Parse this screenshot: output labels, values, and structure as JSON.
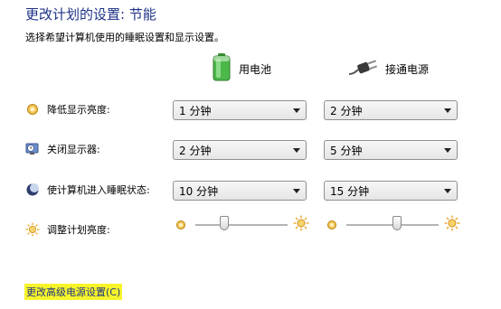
{
  "header": {
    "title": "更改计划的设置: 节能",
    "subtitle": "选择希望计算机使用的睡眠设置和显示设置。"
  },
  "columns": {
    "battery_label": "用电池",
    "ac_label": "接通电源"
  },
  "rows": {
    "dim_display": {
      "label": "降低显示亮度:",
      "battery_value": "1 分钟",
      "ac_value": "2 分钟"
    },
    "turn_off_display": {
      "label": "关闭显示器:",
      "battery_value": "2 分钟",
      "ac_value": "5 分钟"
    },
    "sleep": {
      "label": "使计算机进入睡眠状态:",
      "battery_value": "10 分钟",
      "ac_value": "15 分钟"
    },
    "brightness": {
      "label": "调整计划亮度:",
      "battery_level_percent": 31,
      "ac_level_percent": 55
    }
  },
  "footer": {
    "advanced_link": "更改高级电源设置(C)"
  },
  "colors": {
    "title": "#1e3287",
    "link_highlight": "#f7f52a",
    "battery_green": "#4cb84a",
    "sun_yellow": "#e8a21c"
  }
}
